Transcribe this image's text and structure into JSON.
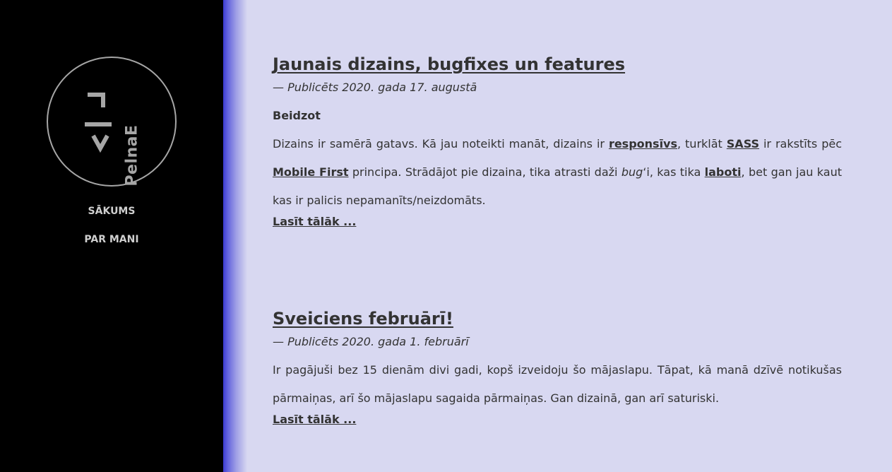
{
  "sidebar": {
    "logo_text": "PelnaE",
    "nav": [
      {
        "label": "SĀKUMS"
      },
      {
        "label": "PAR MANI"
      }
    ]
  },
  "posts": [
    {
      "title": "Jaunais dizains, bugfixes un features",
      "date": "— Publicēts 2020. gada 17. augustā",
      "subtitle": "Beidzot",
      "body": {
        "t1": "Dizains ir samērā gatavs. Kā jau noteikti manāt, dizains ir ",
        "link_responsive": "responsīvs",
        "t2": ", turklāt ",
        "link_sass": "SASS",
        "t3": " ir rakstīts pēc ",
        "link_mobile_first": "Mobile First",
        "t4": " principa. Strādājot pie dizaina, tika atrasti daži ",
        "em_bug": "bug",
        "t5": "‘i, kas tika ",
        "link_laboti": "laboti",
        "t6": ", bet gan jau kaut kas ir palicis nepamanīts/neizdomāts."
      },
      "read_more": "Lasīt tālāk ..."
    },
    {
      "title": "Sveiciens februārī!",
      "date": "— Publicēts 2020. gada 1. februārī",
      "body_text": "Ir pagājuši bez 15 dienām divi gadi, kopš izveidoju šo mājaslapu. Tāpat, kā manā dzīvē notikušas pārmaiņas, arī šo mājaslapu sagaida pārmaiņas. Gan dizainā, gan arī saturiski.",
      "read_more": "Lasīt tālāk ..."
    }
  ],
  "colors": {
    "sidebar_bg": "#000000",
    "content_bg": "#d8d8f1",
    "accent_shadow": "#3b3bd0",
    "text": "#333333"
  }
}
